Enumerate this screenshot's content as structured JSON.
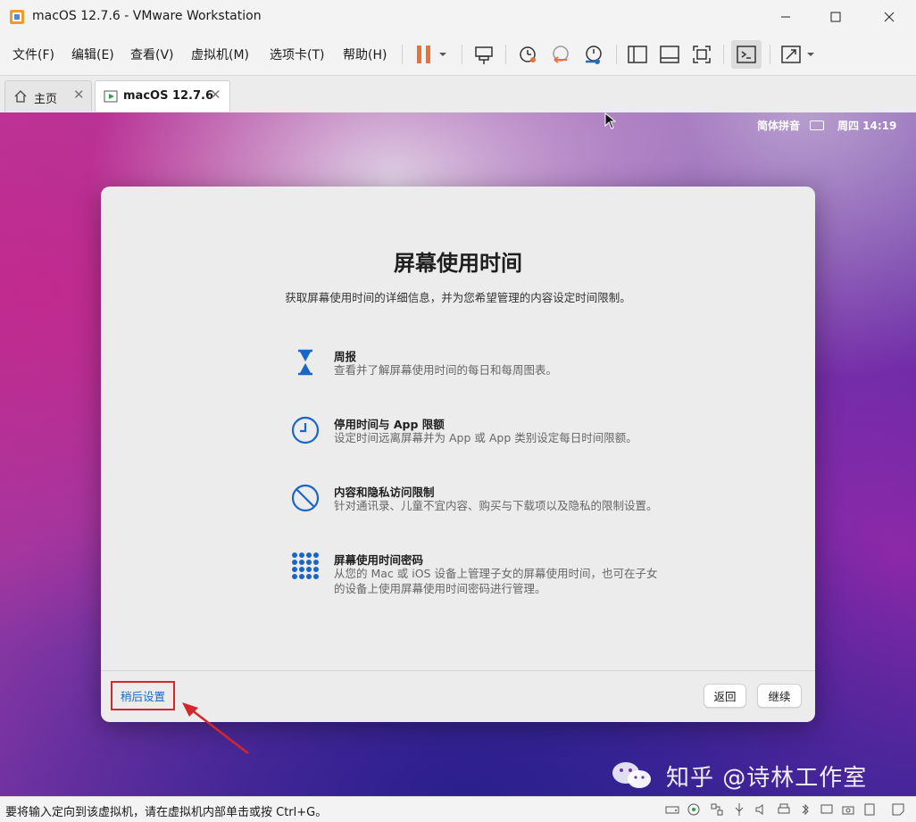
{
  "window": {
    "title": "macOS 12.7.6 - VMware Workstation"
  },
  "menu": [
    "文件(F)",
    "编辑(E)",
    "查看(V)",
    "虚拟机(M)",
    "选项卡(T)",
    "帮助(H)"
  ],
  "tabs": [
    {
      "label": "主页",
      "active": false
    },
    {
      "label": "macOS 12.7.6",
      "active": true
    }
  ],
  "vm_status": {
    "input_method": "简体拼音",
    "clock": "周四 14:19"
  },
  "dialog": {
    "title": "屏幕使用时间",
    "subtitle": "获取屏幕使用时间的详细信息，并为您希望管理的内容设定时间限制。",
    "features": [
      {
        "icon": "hourglass-icon",
        "title": "周报",
        "desc": "查看并了解屏幕使用时间的每日和每周图表。"
      },
      {
        "icon": "clock-icon",
        "title": "停用时间与 App 限额",
        "desc": "设定时间远离屏幕并为 App 或 App 类别设定每日时间限额。"
      },
      {
        "icon": "prohibited-icon",
        "title": "内容和隐私访问限制",
        "desc": "针对通讯录、儿童不宜内容、购买与下载项以及隐私的限制设置。"
      },
      {
        "icon": "keypad-icon",
        "title": "屏幕使用时间密码",
        "desc": "从您的 Mac 或 iOS 设备上管理子女的屏幕使用时间，也可在子女的设备上使用屏幕使用时间密码进行管理。"
      }
    ],
    "set_up_later": "稍后设置",
    "back": "返回",
    "continue": "继续"
  },
  "watermark": "知乎 @诗林工作室",
  "statusbar": {
    "message": "要将输入定向到该虚拟机，请在虚拟机内部单击或按 Ctrl+G。"
  },
  "colors": {
    "accent": "#1a66c8",
    "highlight_box": "#d4272a",
    "pause_orange": "#e8733a"
  }
}
